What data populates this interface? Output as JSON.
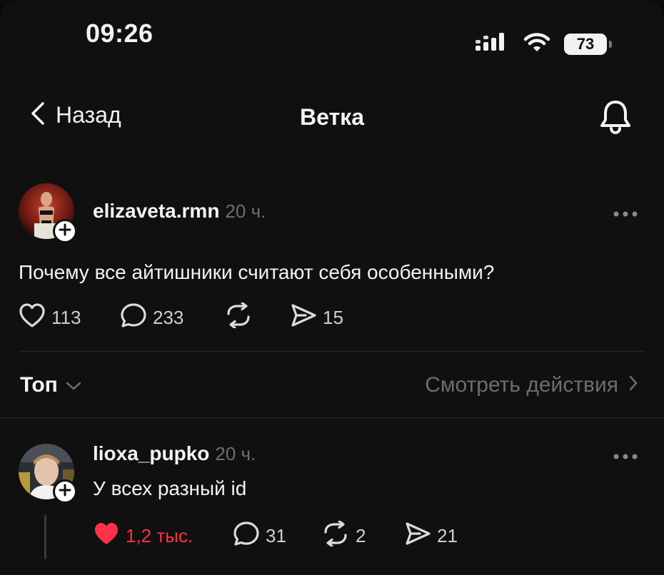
{
  "status_bar": {
    "time": "09:26",
    "battery": "73"
  },
  "nav": {
    "back_label": "Назад",
    "title": "Ветка"
  },
  "post": {
    "username": "elizaveta.rmn",
    "time_ago": "20 ч.",
    "text": "Почему все айтишники считают себя особенными?",
    "likes": "113",
    "comments": "233",
    "shares": "15"
  },
  "sort": {
    "label": "Топ",
    "view_activity": "Смотреть действия"
  },
  "reply": {
    "username": "lioxa_pupko",
    "time_ago": "20 ч.",
    "text": "У всех разный id",
    "likes": "1,2 тыс.",
    "comments": "31",
    "reposts": "2",
    "shares": "21"
  },
  "colors": {
    "background": "#101010",
    "like_active": "#ff3048",
    "muted": "#6e6e6e"
  }
}
